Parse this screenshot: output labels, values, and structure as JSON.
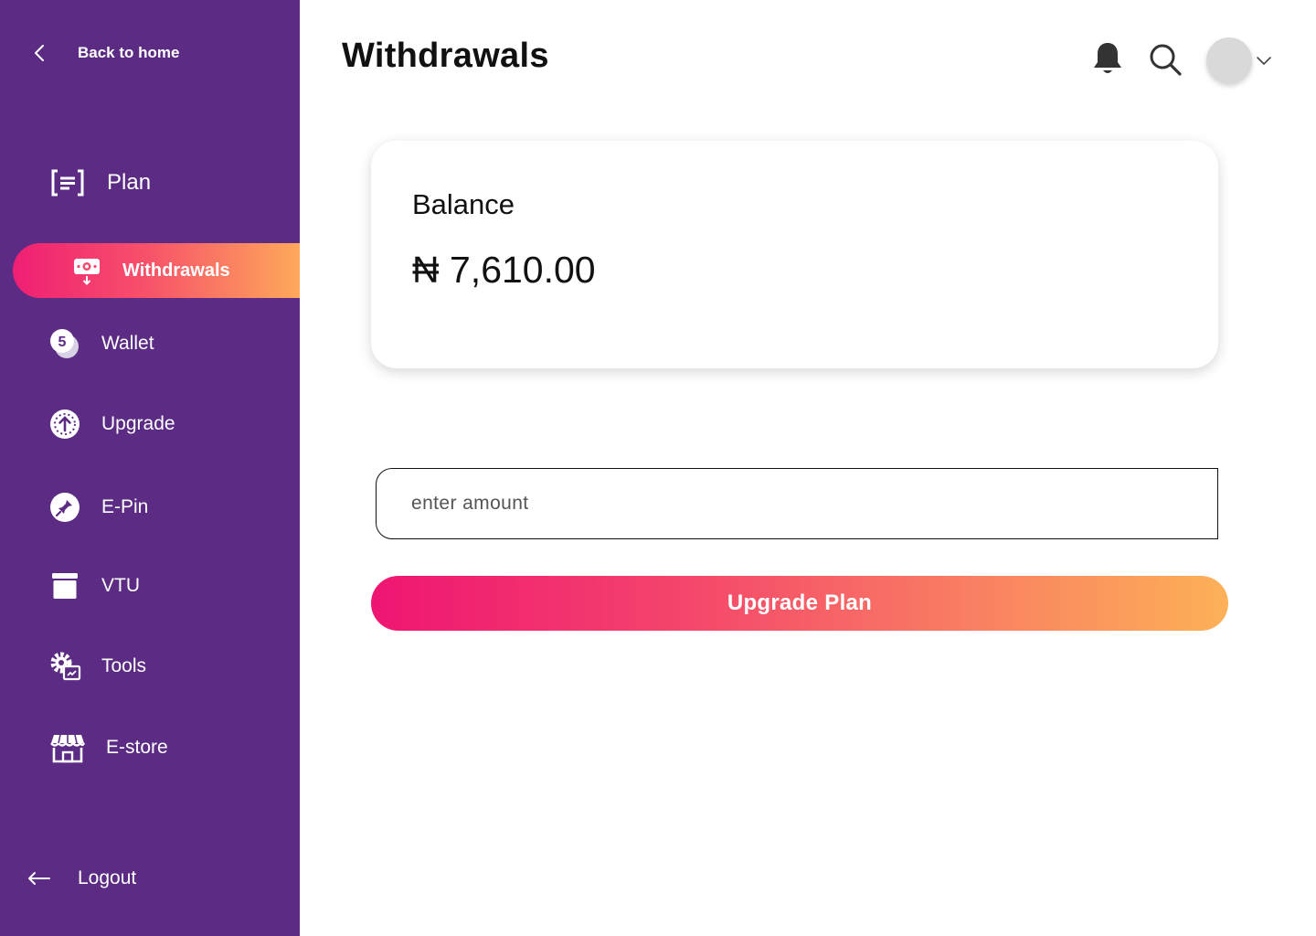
{
  "sidebar": {
    "back_label": "Back to home",
    "section_title": "Plan",
    "active_item": "Withdrawals",
    "items": [
      {
        "label": "Wallet",
        "icon": "wallet-coin-icon"
      },
      {
        "label": "Upgrade",
        "icon": "upgrade-arrow-icon"
      },
      {
        "label": "E-Pin",
        "icon": "pin-icon"
      },
      {
        "label": "VTU",
        "icon": "archive-box-icon"
      },
      {
        "label": "Tools",
        "icon": "tools-gear-icon"
      },
      {
        "label": "E-store",
        "icon": "store-icon"
      }
    ],
    "logout_label": "Logout",
    "colors": {
      "background": "#5c2c84",
      "active_gradient": [
        "#ef1f74",
        "#fda95a"
      ]
    }
  },
  "header": {
    "title": "Withdrawals",
    "icons": [
      "bell-icon",
      "search-icon",
      "avatar",
      "chevron-down-icon"
    ]
  },
  "balance": {
    "label": "Balance",
    "value": "₦ 7,610.00"
  },
  "form": {
    "amount_placeholder": "enter amount",
    "amount_value": "",
    "submit_label": "Upgrade Plan"
  }
}
